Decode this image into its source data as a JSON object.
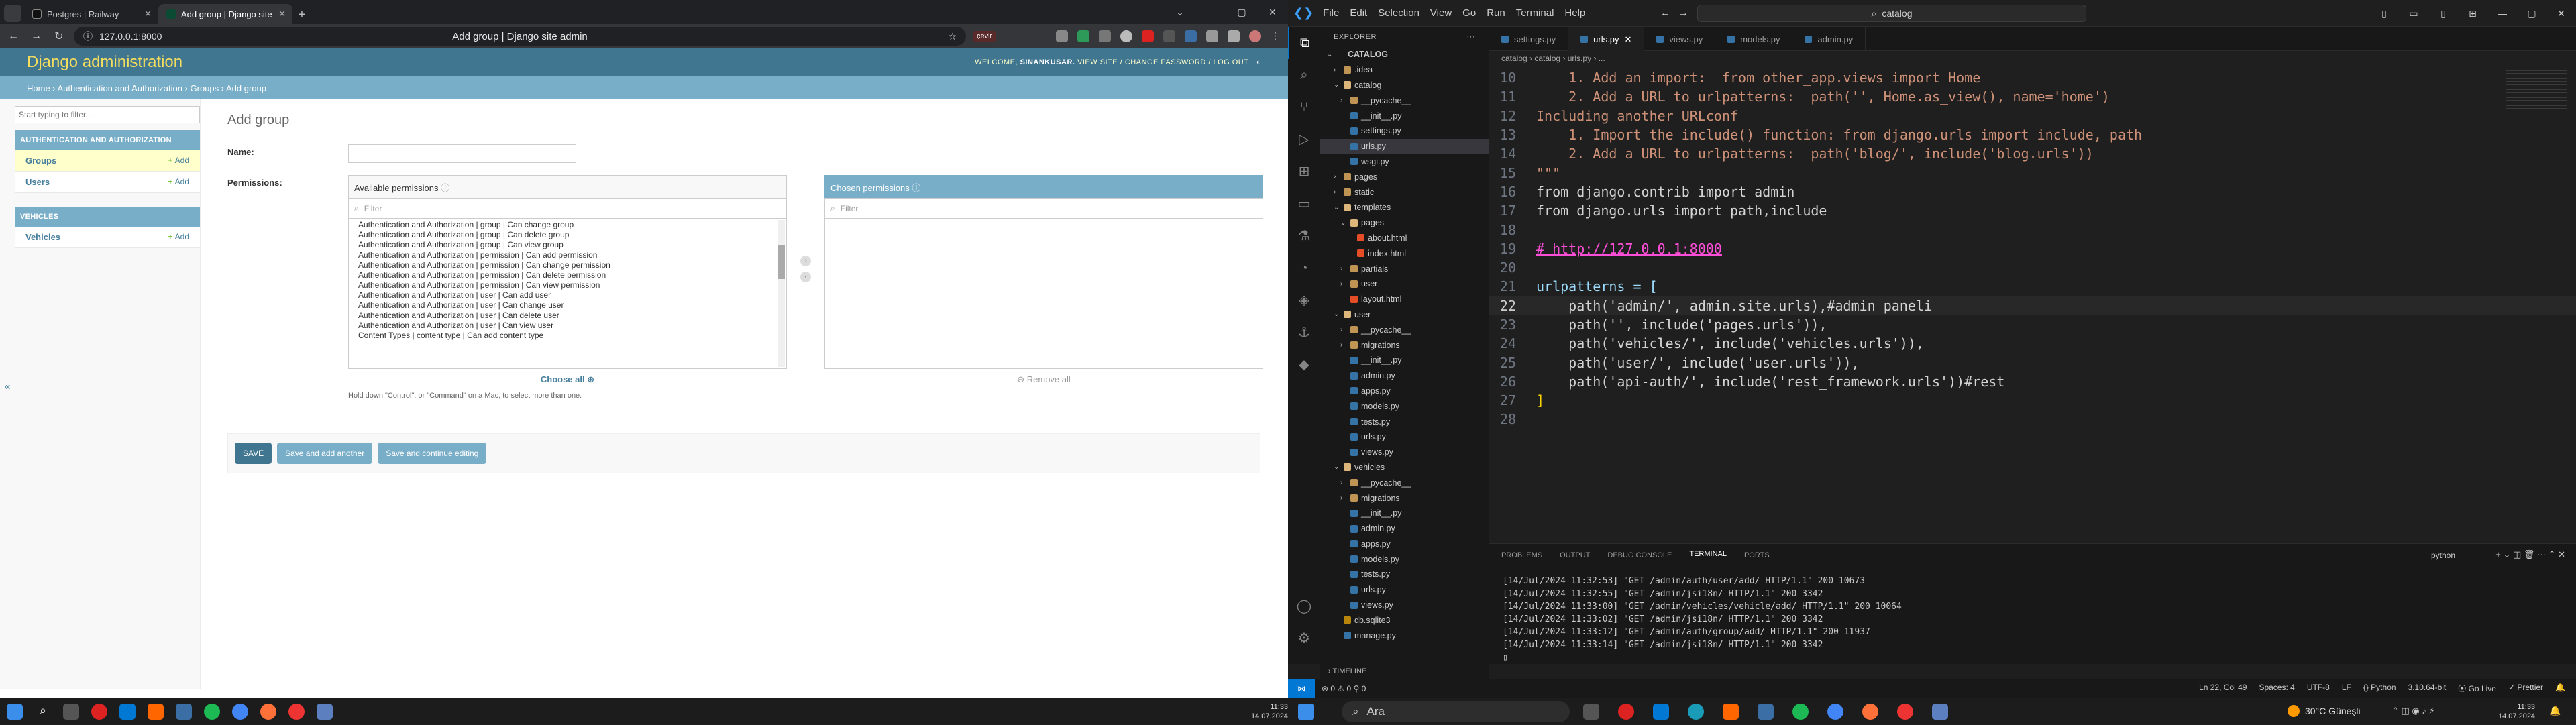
{
  "browser": {
    "tabs": [
      {
        "label": "Postgres | Railway"
      },
      {
        "label": "Add group | Django site"
      }
    ],
    "url": "127.0.0.1:8000",
    "page_title": "Add group | Django site admin",
    "ext_label": "çevir"
  },
  "django": {
    "branding": "Django administration",
    "welcome": "WELCOME,",
    "username": "SINANKUSAR.",
    "user_links": "VIEW SITE / CHANGE PASSWORD / LOG OUT",
    "breadcrumb": "Home › Authentication and Authorization › Groups › Add group",
    "nav_filter_placeholder": "Start typing to filter...",
    "modules": [
      {
        "caption": "AUTHENTICATION AND AUTHORIZATION",
        "rows": [
          {
            "name": "Groups",
            "add": "Add"
          },
          {
            "name": "Users",
            "add": "Add"
          }
        ]
      },
      {
        "caption": "VEHICLES",
        "rows": [
          {
            "name": "Vehicles",
            "add": "Add"
          }
        ]
      }
    ],
    "heading": "Add group",
    "name_label": "Name:",
    "perm_label": "Permissions:",
    "available_title": "Available permissions",
    "chosen_title": "Chosen permissions",
    "filter_placeholder": "Filter",
    "available_items": [
      "Authentication and Authorization | group | Can change group",
      "Authentication and Authorization | group | Can delete group",
      "Authentication and Authorization | group | Can view group",
      "Authentication and Authorization | permission | Can add permission",
      "Authentication and Authorization | permission | Can change permission",
      "Authentication and Authorization | permission | Can delete permission",
      "Authentication and Authorization | permission | Can view permission",
      "Authentication and Authorization | user | Can add user",
      "Authentication and Authorization | user | Can change user",
      "Authentication and Authorization | user | Can delete user",
      "Authentication and Authorization | user | Can view user",
      "Content Types | content type | Can add content type"
    ],
    "choose_all": "Choose all",
    "remove_all": "Remove all",
    "help": "Hold down \"Control\", or \"Command\" on a Mac, to select more than one.",
    "buttons": {
      "save": "SAVE",
      "save_add": "Save and add another",
      "save_continue": "Save and continue editing"
    }
  },
  "vscode": {
    "menu": [
      "File",
      "Edit",
      "Selection",
      "View",
      "Go",
      "Run",
      "Terminal",
      "Help"
    ],
    "command_center": "catalog",
    "explorer_title": "EXPLORER",
    "tree": [
      {
        "label": "CATALOG",
        "indent": 0,
        "kind": "root"
      },
      {
        "label": ".idea",
        "indent": 1,
        "kind": "folder"
      },
      {
        "label": "catalog",
        "indent": 1,
        "kind": "folder-open"
      },
      {
        "label": "__pycache__",
        "indent": 2,
        "kind": "folder"
      },
      {
        "label": "__init__.py",
        "indent": 2,
        "kind": "py"
      },
      {
        "label": "settings.py",
        "indent": 2,
        "kind": "py"
      },
      {
        "label": "urls.py",
        "indent": 2,
        "kind": "py",
        "selected": true
      },
      {
        "label": "wsgi.py",
        "indent": 2,
        "kind": "py"
      },
      {
        "label": "pages",
        "indent": 1,
        "kind": "folder"
      },
      {
        "label": "static",
        "indent": 1,
        "kind": "folder"
      },
      {
        "label": "templates",
        "indent": 1,
        "kind": "folder-open"
      },
      {
        "label": "pages",
        "indent": 2,
        "kind": "folder-open"
      },
      {
        "label": "about.html",
        "indent": 3,
        "kind": "html"
      },
      {
        "label": "index.html",
        "indent": 3,
        "kind": "html"
      },
      {
        "label": "partials",
        "indent": 2,
        "kind": "folder"
      },
      {
        "label": "user",
        "indent": 2,
        "kind": "folder"
      },
      {
        "label": "layout.html",
        "indent": 2,
        "kind": "html"
      },
      {
        "label": "user",
        "indent": 1,
        "kind": "folder-open"
      },
      {
        "label": "__pycache__",
        "indent": 2,
        "kind": "folder"
      },
      {
        "label": "migrations",
        "indent": 2,
        "kind": "folder"
      },
      {
        "label": "__init__.py",
        "indent": 2,
        "kind": "py"
      },
      {
        "label": "admin.py",
        "indent": 2,
        "kind": "py"
      },
      {
        "label": "apps.py",
        "indent": 2,
        "kind": "py"
      },
      {
        "label": "models.py",
        "indent": 2,
        "kind": "py"
      },
      {
        "label": "tests.py",
        "indent": 2,
        "kind": "py"
      },
      {
        "label": "urls.py",
        "indent": 2,
        "kind": "py"
      },
      {
        "label": "views.py",
        "indent": 2,
        "kind": "py"
      },
      {
        "label": "vehicles",
        "indent": 1,
        "kind": "folder-open"
      },
      {
        "label": "__pycache__",
        "indent": 2,
        "kind": "folder"
      },
      {
        "label": "migrations",
        "indent": 2,
        "kind": "folder"
      },
      {
        "label": "__init__.py",
        "indent": 2,
        "kind": "py"
      },
      {
        "label": "admin.py",
        "indent": 2,
        "kind": "py"
      },
      {
        "label": "apps.py",
        "indent": 2,
        "kind": "py"
      },
      {
        "label": "models.py",
        "indent": 2,
        "kind": "py"
      },
      {
        "label": "tests.py",
        "indent": 2,
        "kind": "py"
      },
      {
        "label": "urls.py",
        "indent": 2,
        "kind": "py"
      },
      {
        "label": "views.py",
        "indent": 2,
        "kind": "py"
      },
      {
        "label": "db.sqlite3",
        "indent": 1,
        "kind": "db"
      },
      {
        "label": "manage.py",
        "indent": 1,
        "kind": "py"
      }
    ],
    "timeline": "TIMELINE",
    "tabs": [
      "settings.py",
      "urls.py",
      "views.py",
      "models.py",
      "admin.py"
    ],
    "active_tab": "urls.py",
    "breadcrumb": "catalog › catalog › urls.py › ...",
    "code": [
      {
        "n": "10",
        "t": "    1. Add an import:  from other_app.views import Home",
        "c": "#ce9178"
      },
      {
        "n": "11",
        "t": "    2. Add a URL to urlpatterns:  path('', Home.as_view(), name='home')",
        "c": "#ce9178"
      },
      {
        "n": "12",
        "t": "Including another URLconf",
        "c": "#ce9178"
      },
      {
        "n": "13",
        "t": "    1. Import the include() function: from django.urls import include, path",
        "c": "#ce9178"
      },
      {
        "n": "14",
        "t": "    2. Add a URL to urlpatterns:  path('blog/', include('blog.urls'))",
        "c": "#ce9178"
      },
      {
        "n": "15",
        "t": "\"\"\"",
        "c": "#ce9178"
      },
      {
        "n": "16",
        "t": "from django.contrib import admin",
        "c": "#d4d4d4"
      },
      {
        "n": "17",
        "t": "from django.urls import path,include",
        "c": "#d4d4d4"
      },
      {
        "n": "18",
        "t": "",
        "c": "#d4d4d4"
      },
      {
        "n": "19",
        "t": "# http://127.0.0.1:8000",
        "c": "#ff4fd8"
      },
      {
        "n": "20",
        "t": "",
        "c": "#d4d4d4"
      },
      {
        "n": "21",
        "t": "urlpatterns = [",
        "c": "#9cdcfe"
      },
      {
        "n": "22",
        "t": "    path('admin/', admin.site.urls),#admin paneli",
        "c": "#d4d4d4"
      },
      {
        "n": "23",
        "t": "    path('', include('pages.urls')),",
        "c": "#d4d4d4"
      },
      {
        "n": "24",
        "t": "    path('vehicles/', include('vehicles.urls')),",
        "c": "#d4d4d4"
      },
      {
        "n": "25",
        "t": "    path('user/', include('user.urls')),",
        "c": "#d4d4d4"
      },
      {
        "n": "26",
        "t": "    path('api-auth/', include('rest_framework.urls'))#rest",
        "c": "#d4d4d4"
      },
      {
        "n": "27",
        "t": "]",
        "c": "#ffd700"
      },
      {
        "n": "28",
        "t": "",
        "c": "#d4d4d4"
      }
    ],
    "current_line": "22",
    "panel_tabs": [
      "PROBLEMS",
      "OUTPUT",
      "DEBUG CONSOLE",
      "TERMINAL",
      "PORTS"
    ],
    "active_panel": "TERMINAL",
    "panel_lang": "python",
    "terminal": [
      "[14/Jul/2024 11:32:53] \"GET /admin/auth/user/add/ HTTP/1.1\" 200 10673",
      "[14/Jul/2024 11:32:55] \"GET /admin/jsi18n/ HTTP/1.1\" 200 3342",
      "[14/Jul/2024 11:33:00] \"GET /admin/vehicles/vehicle/add/ HTTP/1.1\" 200 10064",
      "[14/Jul/2024 11:33:02] \"GET /admin/jsi18n/ HTTP/1.1\" 200 3342",
      "[14/Jul/2024 11:33:12] \"GET /admin/auth/group/add/ HTTP/1.1\" 200 11937",
      "[14/Jul/2024 11:33:14] \"GET /admin/jsi18n/ HTTP/1.1\" 200 3342"
    ],
    "status": {
      "left": "⊗ 0 ⚠ 0   ⚲ 0",
      "position": "Ln 22, Col 49",
      "spaces": "Spaces: 4",
      "enc": "UTF-8",
      "eol": "LF",
      "lang": "{} Python",
      "interp": "3.10.64-bit",
      "golive": "⦿ Go Live",
      "prettier": "✓ Prettier"
    }
  },
  "taskbar": {
    "search": "Ara",
    "weather": "30°C Güneşli",
    "time_left": "11:33",
    "date_left": "14.07.2024",
    "time_right": "11:33",
    "date_right": "14.07.2024"
  },
  "colors": {
    "django_primary": "#417690",
    "django_secondary": "#79aec8",
    "vscode_accent": "#0078d4"
  }
}
